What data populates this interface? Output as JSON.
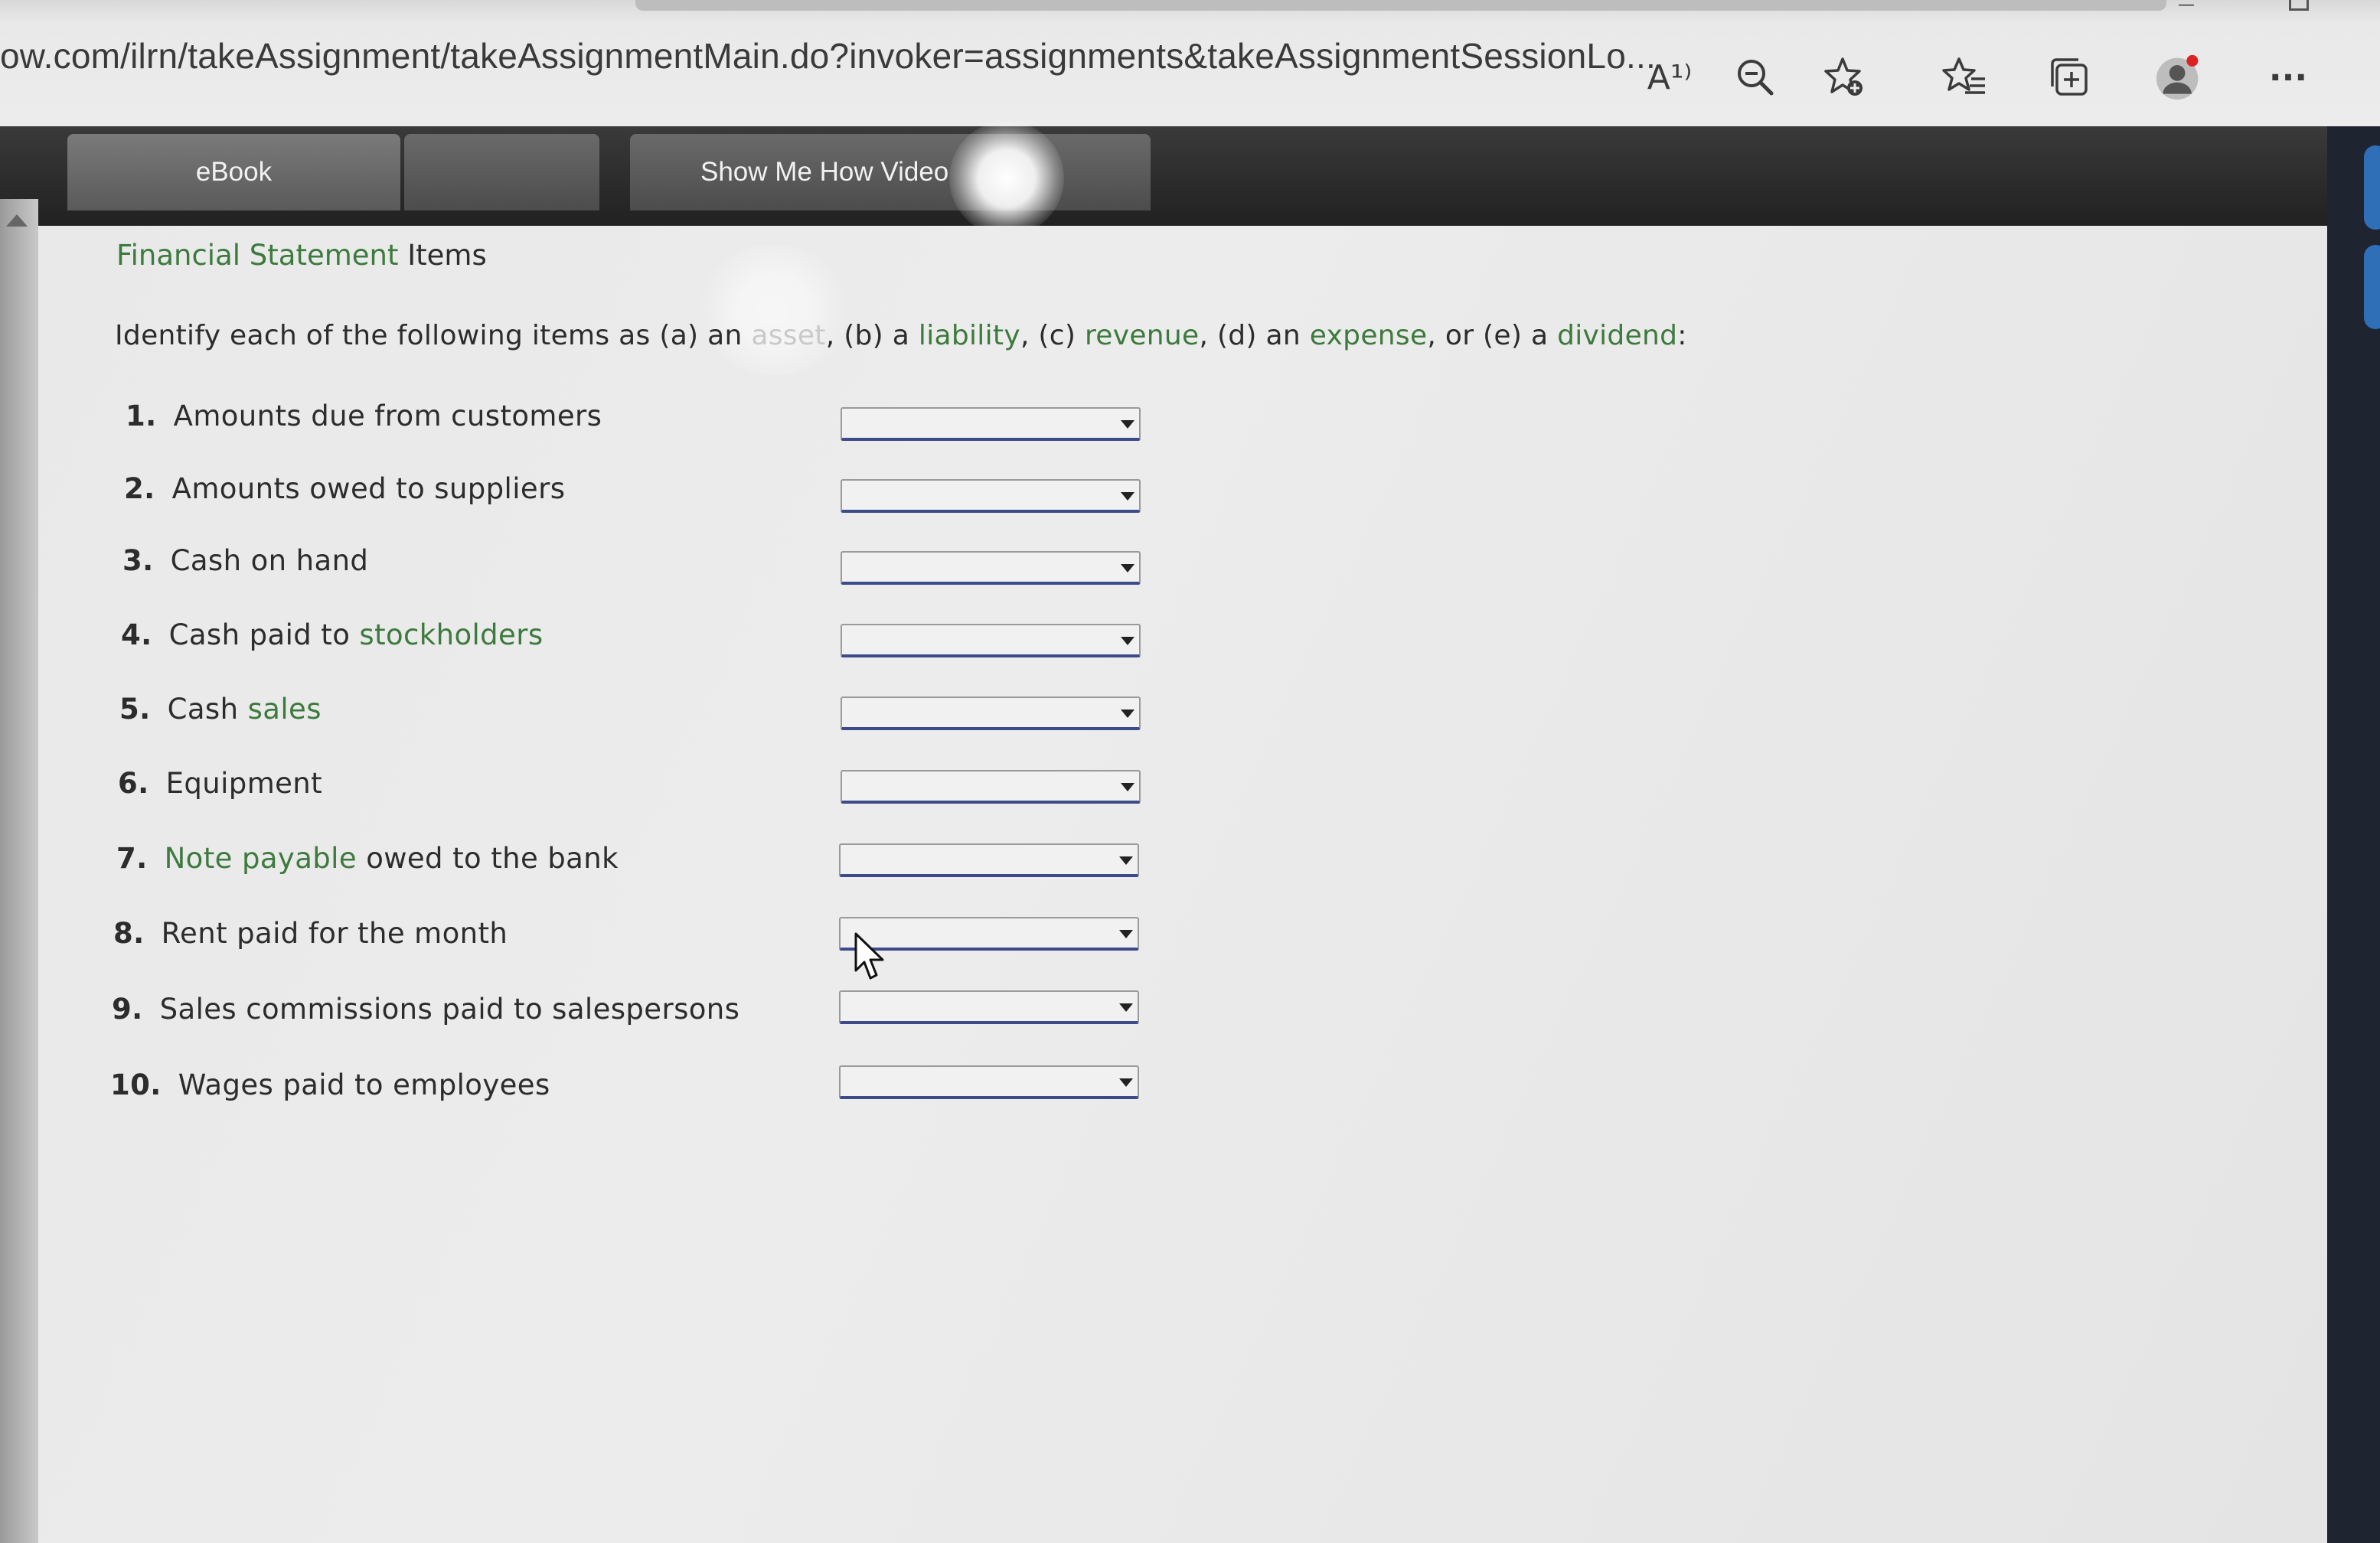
{
  "browser": {
    "url": "ow.com/ilrn/takeAssignment/takeAssignmentMain.do?invoker=assignments&takeAssignmentSessionLo...",
    "read_aloud_glyph": "A¹⁾",
    "more_glyph": "···"
  },
  "tabs": {
    "ebook_label": "eBook",
    "blank_label": "",
    "video_label": "Show Me How Video"
  },
  "content": {
    "title_part1": "Financial Statement",
    "title_part2": " Items",
    "instructions": {
      "t1": "Identify each of the following items as (a) an ",
      "asset": "asset",
      "t2": ", (b) a ",
      "liability": "liability",
      "t3": ", (c) ",
      "revenue": "revenue",
      "t4": ", (d) an ",
      "expense": "expense",
      "t5": ", or (e) a ",
      "dividend": "dividend",
      "t6": ":"
    },
    "items": [
      {
        "num": "1.",
        "a": "Amounts due from customers",
        "g": "",
        "b": "",
        "selected": ""
      },
      {
        "num": "2.",
        "a": "Amounts owed to suppliers",
        "g": "",
        "b": "",
        "selected": ""
      },
      {
        "num": "3.",
        "a": "Cash on hand",
        "g": "",
        "b": "",
        "selected": ""
      },
      {
        "num": "4.",
        "a": "Cash paid to ",
        "g": "stockholders",
        "b": "",
        "selected": ""
      },
      {
        "num": "5.",
        "a": "Cash ",
        "g": "sales",
        "b": "",
        "selected": ""
      },
      {
        "num": "6.",
        "a": "Equipment",
        "g": "",
        "b": "",
        "selected": ""
      },
      {
        "num": "7.",
        "a": "",
        "g": "Note payable",
        "b": " owed to the bank",
        "selected": ""
      },
      {
        "num": "8.",
        "a": "Rent paid for the month",
        "g": "",
        "b": "",
        "selected": ""
      },
      {
        "num": "9.",
        "a": "Sales commissions paid to salespersons",
        "g": "",
        "b": "",
        "selected": ""
      },
      {
        "num": "10.",
        "a": "Wages paid to employees",
        "g": "",
        "b": "",
        "selected": ""
      }
    ]
  },
  "colors": {
    "term_green": "#3d7a3d",
    "dropdown_underline": "#3e4b8a"
  },
  "icons": [
    "read-aloud-icon",
    "zoom-out-icon",
    "add-favorite-icon",
    "favorites-icon",
    "collections-icon",
    "profile-avatar-icon",
    "more-options-icon",
    "dropdown-caret-icon",
    "mouse-cursor-icon"
  ]
}
